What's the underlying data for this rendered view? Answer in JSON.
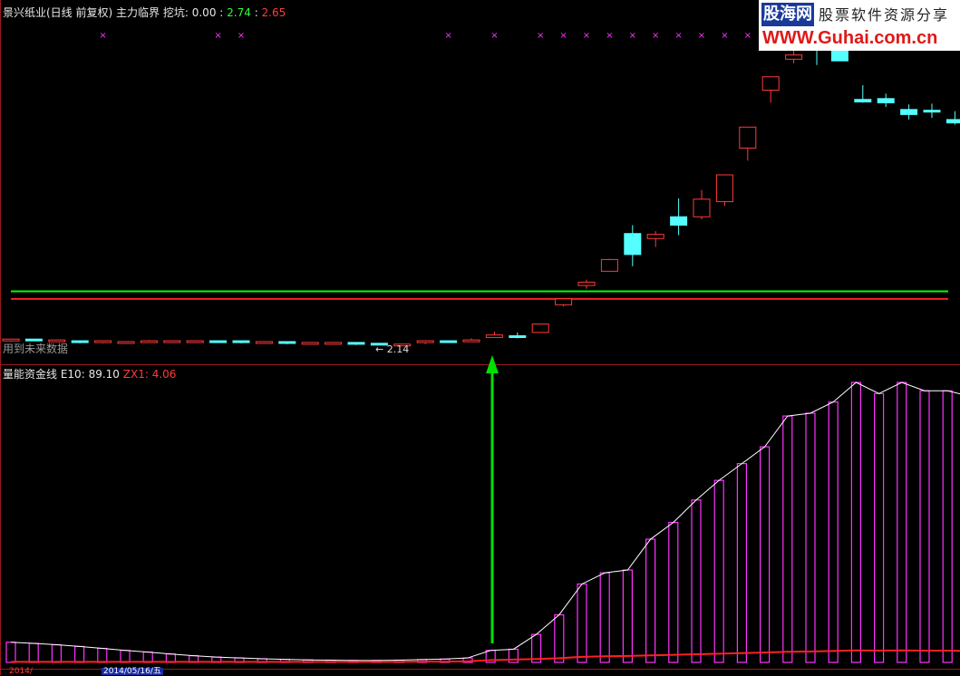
{
  "top_header": {
    "stock_name": "景兴纸业(日线 前复权)",
    "indicator_name": "主力临界",
    "wakeng_label": "挖坑",
    "wakeng_value": "0.00",
    "value_green": "2.74",
    "value_red": "2.65"
  },
  "price_pane": {
    "future_data_note": "用到未来数据",
    "low_marker": "← 2.14",
    "green_line": 2.74,
    "red_line": 2.65,
    "x_markers_at": [
      4,
      9,
      10,
      19,
      21,
      23,
      24,
      25,
      26,
      27,
      28,
      29,
      30,
      31,
      32
    ]
  },
  "bottom_header": {
    "indicator_name": "量能资金线",
    "e10_label": "E10",
    "e10_value": "89.10",
    "zx1_label": "ZX1",
    "zx1_value": "4.06"
  },
  "footer": {
    "date_label_1": "2014/",
    "date_label_2": "2014/05/16/五"
  },
  "watermark": {
    "logo": "股海网",
    "slogan": "股票软件资源分享",
    "url": "WWW.Guhai.com.cn"
  },
  "colors": {
    "up": "#ff3b3b",
    "down": "#55ffff",
    "green_line": "#00ff00",
    "red_line": "#ff2020",
    "magenta": "#ff33ff",
    "frame": "#9a1a1a"
  },
  "chart_data": [
    {
      "type": "candlestick",
      "title": "景兴纸业(日线 前复权)",
      "ohlc": [
        [
          2.14,
          2.17,
          2.14,
          2.16
        ],
        [
          2.16,
          2.17,
          2.15,
          2.15
        ],
        [
          2.15,
          2.16,
          2.14,
          2.15
        ],
        [
          2.14,
          2.15,
          2.12,
          2.13
        ],
        [
          2.12,
          2.15,
          2.12,
          2.14
        ],
        [
          2.13,
          2.14,
          2.12,
          2.13
        ],
        [
          2.14,
          2.16,
          2.13,
          2.14
        ],
        [
          2.14,
          2.15,
          2.13,
          2.14
        ],
        [
          2.14,
          2.15,
          2.13,
          2.14
        ],
        [
          2.14,
          2.15,
          2.13,
          2.13
        ],
        [
          2.14,
          2.14,
          2.12,
          2.13
        ],
        [
          2.12,
          2.14,
          2.12,
          2.13
        ],
        [
          2.13,
          2.14,
          2.11,
          2.12
        ],
        [
          2.12,
          2.13,
          2.11,
          2.12
        ],
        [
          2.12,
          2.13,
          2.11,
          2.12
        ],
        [
          2.12,
          2.12,
          2.1,
          2.11
        ],
        [
          2.11,
          2.12,
          2.1,
          2.1
        ],
        [
          2.1,
          2.11,
          2.09,
          2.1
        ],
        [
          2.12,
          2.14,
          2.11,
          2.14
        ],
        [
          2.14,
          2.14,
          2.13,
          2.13
        ],
        [
          2.15,
          2.18,
          2.15,
          2.15
        ],
        [
          2.19,
          2.26,
          2.19,
          2.22
        ],
        [
          2.2,
          2.25,
          2.18,
          2.19
        ],
        [
          2.25,
          2.35,
          2.25,
          2.35
        ],
        [
          2.58,
          2.66,
          2.56,
          2.65
        ],
        [
          2.81,
          2.88,
          2.77,
          2.85
        ],
        [
          2.98,
          3.13,
          2.98,
          3.12
        ],
        [
          3.43,
          3.53,
          3.04,
          3.18
        ],
        [
          3.37,
          3.46,
          3.27,
          3.42
        ],
        [
          3.63,
          3.85,
          3.41,
          3.53
        ],
        [
          3.63,
          3.95,
          3.6,
          3.84
        ],
        [
          3.81,
          4.13,
          3.76,
          4.13
        ],
        [
          4.45,
          4.6,
          4.3,
          4.7
        ],
        [
          5.14,
          5.29,
          4.99,
          5.3
        ],
        [
          5.51,
          5.71,
          5.46,
          5.56
        ],
        [
          5.7,
          5.99,
          5.44,
          5.65
        ],
        [
          5.72,
          5.72,
          5.49,
          5.49
        ],
        [
          5.03,
          5.2,
          4.99,
          5.0
        ],
        [
          5.04,
          5.1,
          4.94,
          4.99
        ],
        [
          4.91,
          4.97,
          4.79,
          4.85
        ],
        [
          4.89,
          4.98,
          4.81,
          4.87
        ],
        [
          4.79,
          4.89,
          4.73,
          4.75
        ]
      ],
      "ylim": [
        2.0,
        6.0
      ]
    },
    {
      "type": "bar",
      "title": "量能资金线",
      "series": [
        {
          "name": "E10",
          "values": [
            7.2,
            6.8,
            6.3,
            5.7,
            5.0,
            4.3,
            3.7,
            3.0,
            2.4,
            1.9,
            1.6,
            1.3,
            1.1,
            0.9,
            0.8,
            0.7,
            0.7,
            0.8,
            1.0,
            1.2,
            1.6,
            4.3,
            4.7,
            10.0,
            17.0,
            28.0,
            32.0,
            33.0,
            44.0,
            50.0,
            58.0,
            65.0,
            71.0,
            77.0,
            88.0,
            89.0,
            93.0,
            100.0,
            96.0,
            100.0,
            97.0,
            97.0,
            95.0,
            90.0,
            89.1
          ]
        },
        {
          "name": "ZX1",
          "values": [
            0.2,
            0.2,
            0.2,
            0.2,
            0.2,
            0.2,
            0.2,
            0.2,
            0.2,
            0.2,
            0.2,
            0.2,
            0.2,
            0.2,
            0.2,
            0.2,
            0.2,
            0.2,
            0.3,
            0.3,
            0.4,
            0.8,
            1.0,
            1.2,
            1.5,
            2.0,
            2.2,
            2.3,
            2.5,
            2.7,
            2.9,
            3.1,
            3.3,
            3.5,
            3.8,
            3.9,
            4.1,
            4.3,
            4.2,
            4.3,
            4.2,
            4.2,
            4.1,
            4.1,
            4.06
          ]
        }
      ],
      "ylim": [
        0,
        100
      ]
    }
  ]
}
